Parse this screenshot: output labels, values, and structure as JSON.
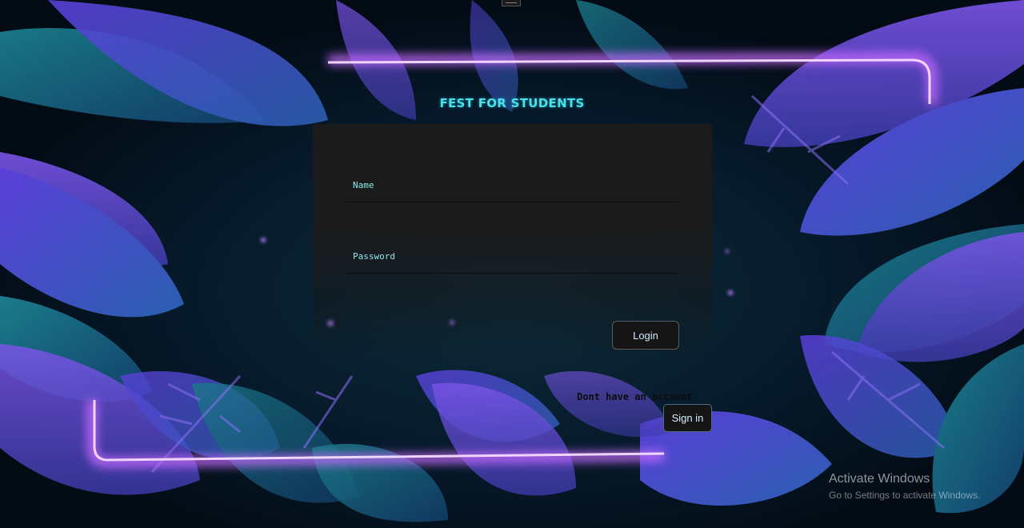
{
  "app": {
    "title": "FEST FOR STUDENTS"
  },
  "login_form": {
    "name_label": "Name",
    "password_label": "Password",
    "login_button": "Login"
  },
  "signup": {
    "prompt": "Dont have an account",
    "button": "Sign in"
  },
  "windows_watermark": {
    "title": "Activate Windows",
    "subtitle": "Go to Settings to activate Windows."
  },
  "colors": {
    "accent": "#4fdfe8",
    "neon": "#c86bff",
    "card": "#1b1b1b"
  }
}
